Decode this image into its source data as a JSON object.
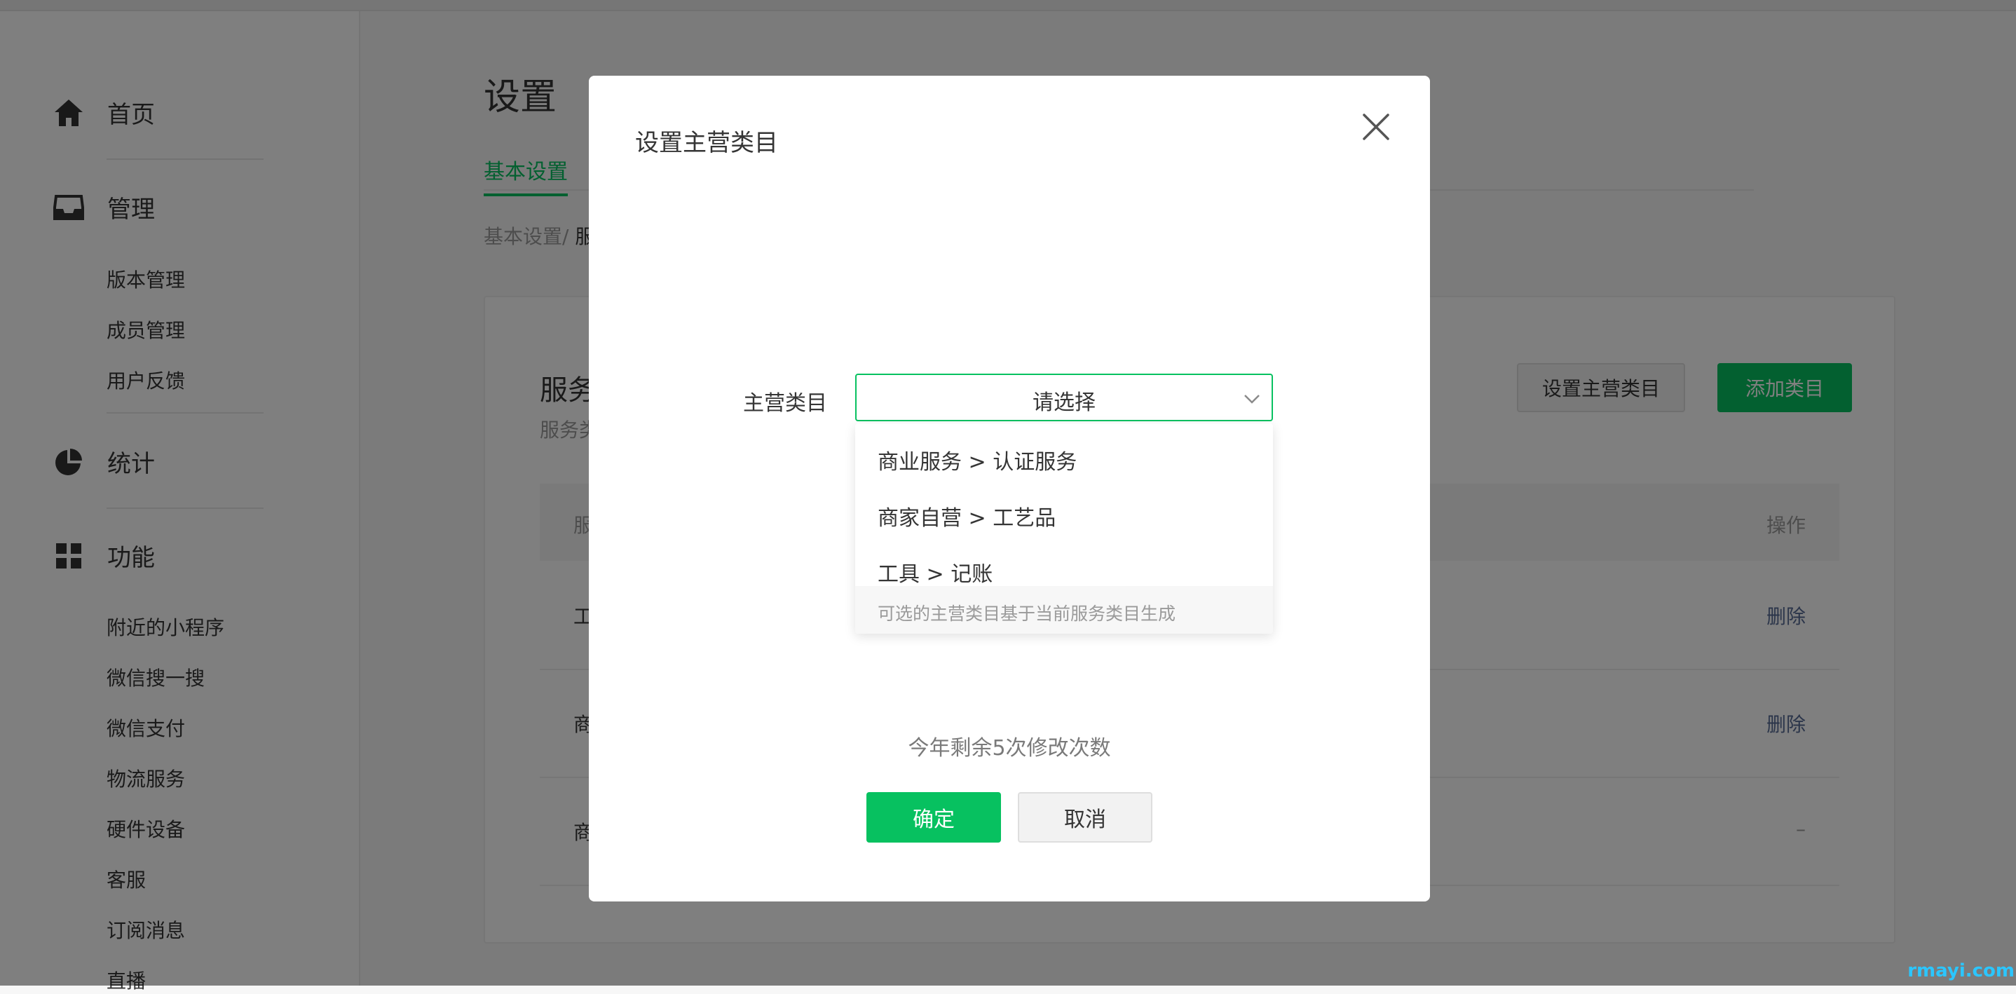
{
  "sidebar": {
    "groups": [
      {
        "label": "首页",
        "icon": "home-icon"
      },
      {
        "label": "管理",
        "icon": "inbox-icon"
      },
      {
        "label": "统计",
        "icon": "pie-chart-icon"
      },
      {
        "label": "功能",
        "icon": "grid-icon"
      }
    ],
    "manage_items": [
      "版本管理",
      "成员管理",
      "用户反馈"
    ],
    "feature_items": [
      "附近的小程序",
      "微信搜一搜",
      "微信支付",
      "物流服务",
      "硬件设备",
      "客服",
      "订阅消息",
      "直播"
    ]
  },
  "main": {
    "title": "设置",
    "tab_active": "基本设置",
    "breadcrumb": {
      "parent": "基本设置",
      "sep": "/ ",
      "current": "服"
    },
    "card": {
      "title": "服务",
      "subtitle": "服务类",
      "set_main_button": "设置主营类目",
      "add_button": "添加类目",
      "header_col1": "服",
      "header_col2": "操作",
      "rows": [
        {
          "col1": "工",
          "action": "删除"
        },
        {
          "col1": "商",
          "action": "删除"
        },
        {
          "col1": "商",
          "action": "–"
        }
      ]
    }
  },
  "dialog": {
    "title": "设置主营类目",
    "field_label": "主营类目",
    "select_placeholder": "请选择",
    "options": [
      "商业服务 > 认证服务",
      "商家自营 > 工艺品",
      "工具 > 记账"
    ],
    "dropdown_hint": "可选的主营类目基于当前服务类目生成",
    "remaining_text": "今年剩余5次修改次数",
    "confirm": "确定",
    "cancel": "取消"
  },
  "colors": {
    "accent": "#07c160",
    "link": "#576b95"
  },
  "watermark": "rmayi.com"
}
